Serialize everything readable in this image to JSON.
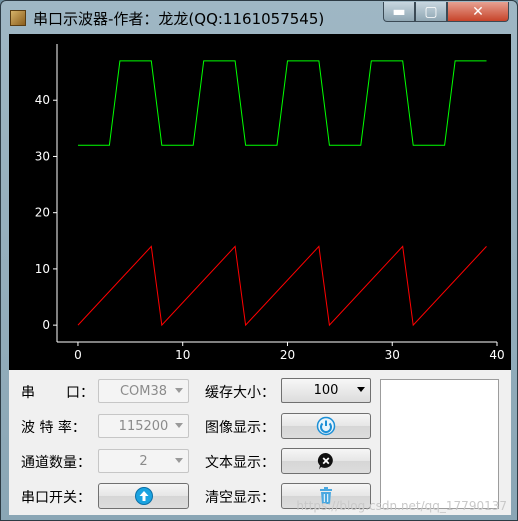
{
  "window": {
    "title": "串口示波器-作者：龙龙(QQ:1161057545)",
    "buttons": {
      "minimize": "▬",
      "maximize": "▢",
      "close": "✕"
    }
  },
  "chart_data": {
    "type": "line",
    "xlim": [
      -2,
      40
    ],
    "ylim": [
      -3,
      50
    ],
    "xticks": [
      "0",
      "10",
      "20",
      "30",
      "40"
    ],
    "yticks": [
      "0",
      "10",
      "20",
      "30",
      "40"
    ],
    "colors": {
      "background": "#000000",
      "axis": "#ffffff"
    },
    "series": [
      {
        "color": "#00ff00",
        "x": [
          0,
          3,
          4,
          7,
          8,
          11,
          12,
          15,
          16,
          19,
          20,
          23,
          24,
          27,
          28,
          31,
          32,
          35,
          36,
          39
        ],
        "y": [
          32,
          32,
          47,
          47,
          32,
          32,
          47,
          47,
          32,
          32,
          47,
          47,
          32,
          32,
          47,
          47,
          32,
          32,
          47,
          47
        ]
      },
      {
        "color": "#ff0000",
        "x": [
          0,
          7,
          8,
          15,
          16,
          23,
          24,
          31,
          32,
          39
        ],
        "y": [
          0,
          14,
          0,
          14,
          0,
          14,
          0,
          14,
          0,
          14
        ]
      }
    ]
  },
  "controls": {
    "port_label_1": "串",
    "port_label_2": "口：",
    "port_value": "COM38",
    "baud_label": "波 特 率：",
    "baud_value": "115200",
    "channels_label": "通道数量：",
    "channels_value": "2",
    "serial_switch_label": "串口开关：",
    "buffer_label": "缓存大小：",
    "buffer_value": "100",
    "image_label": "图像显示：",
    "text_label": "文本显示：",
    "clear_label": "清空显示："
  },
  "watermark": "https://blog.csdn.net/qq_17790137"
}
